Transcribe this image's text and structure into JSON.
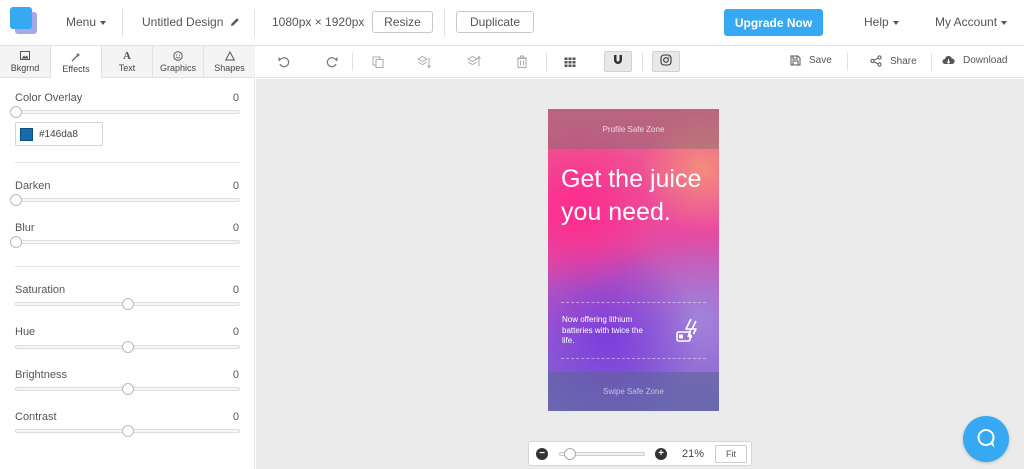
{
  "header": {
    "menu_label": "Menu",
    "design_title": "Untitled Design",
    "dimensions": "1080px × 1920px",
    "resize_label": "Resize",
    "duplicate_label": "Duplicate",
    "upgrade_label": "Upgrade Now",
    "help_label": "Help",
    "account_label": "My Account"
  },
  "tabs": [
    {
      "label": "Bkgrnd",
      "icon": "image-icon"
    },
    {
      "label": "Effects",
      "icon": "wand-icon",
      "active": true
    },
    {
      "label": "Text",
      "icon": "text-icon"
    },
    {
      "label": "Graphics",
      "icon": "smiley-icon"
    },
    {
      "label": "Shapes",
      "icon": "triangle-icon"
    }
  ],
  "effects": {
    "color_overlay": {
      "label": "Color Overlay",
      "value": "0",
      "level": 0,
      "color": "#146da8",
      "color_text": "#146da8"
    },
    "darken": {
      "label": "Darken",
      "value": "0",
      "level": 0
    },
    "blur": {
      "label": "Blur",
      "value": "0",
      "level": 0
    },
    "saturation": {
      "label": "Saturation",
      "value": "0",
      "level": 0.5
    },
    "hue": {
      "label": "Hue",
      "value": "0",
      "level": 0.5
    },
    "brightness": {
      "label": "Brightness",
      "value": "0",
      "level": 0.5
    },
    "contrast": {
      "label": "Contrast",
      "value": "0",
      "level": 0.5
    }
  },
  "toolbar": {
    "save_label": "Save",
    "share_label": "Share",
    "download_label": "Download"
  },
  "design": {
    "safe_top": "Profile Safe Zone",
    "headline": "Get the juice you need.",
    "subtext": "Now offering lithium batteries with twice the life.",
    "safe_bottom": "Swipe Safe Zone"
  },
  "zoom": {
    "minus": "−",
    "plus": "+",
    "value": "21%",
    "fit_label": "Fit",
    "level": 0.05
  },
  "colors": {
    "accent": "#36a9f2",
    "overlay": "#146da8"
  }
}
